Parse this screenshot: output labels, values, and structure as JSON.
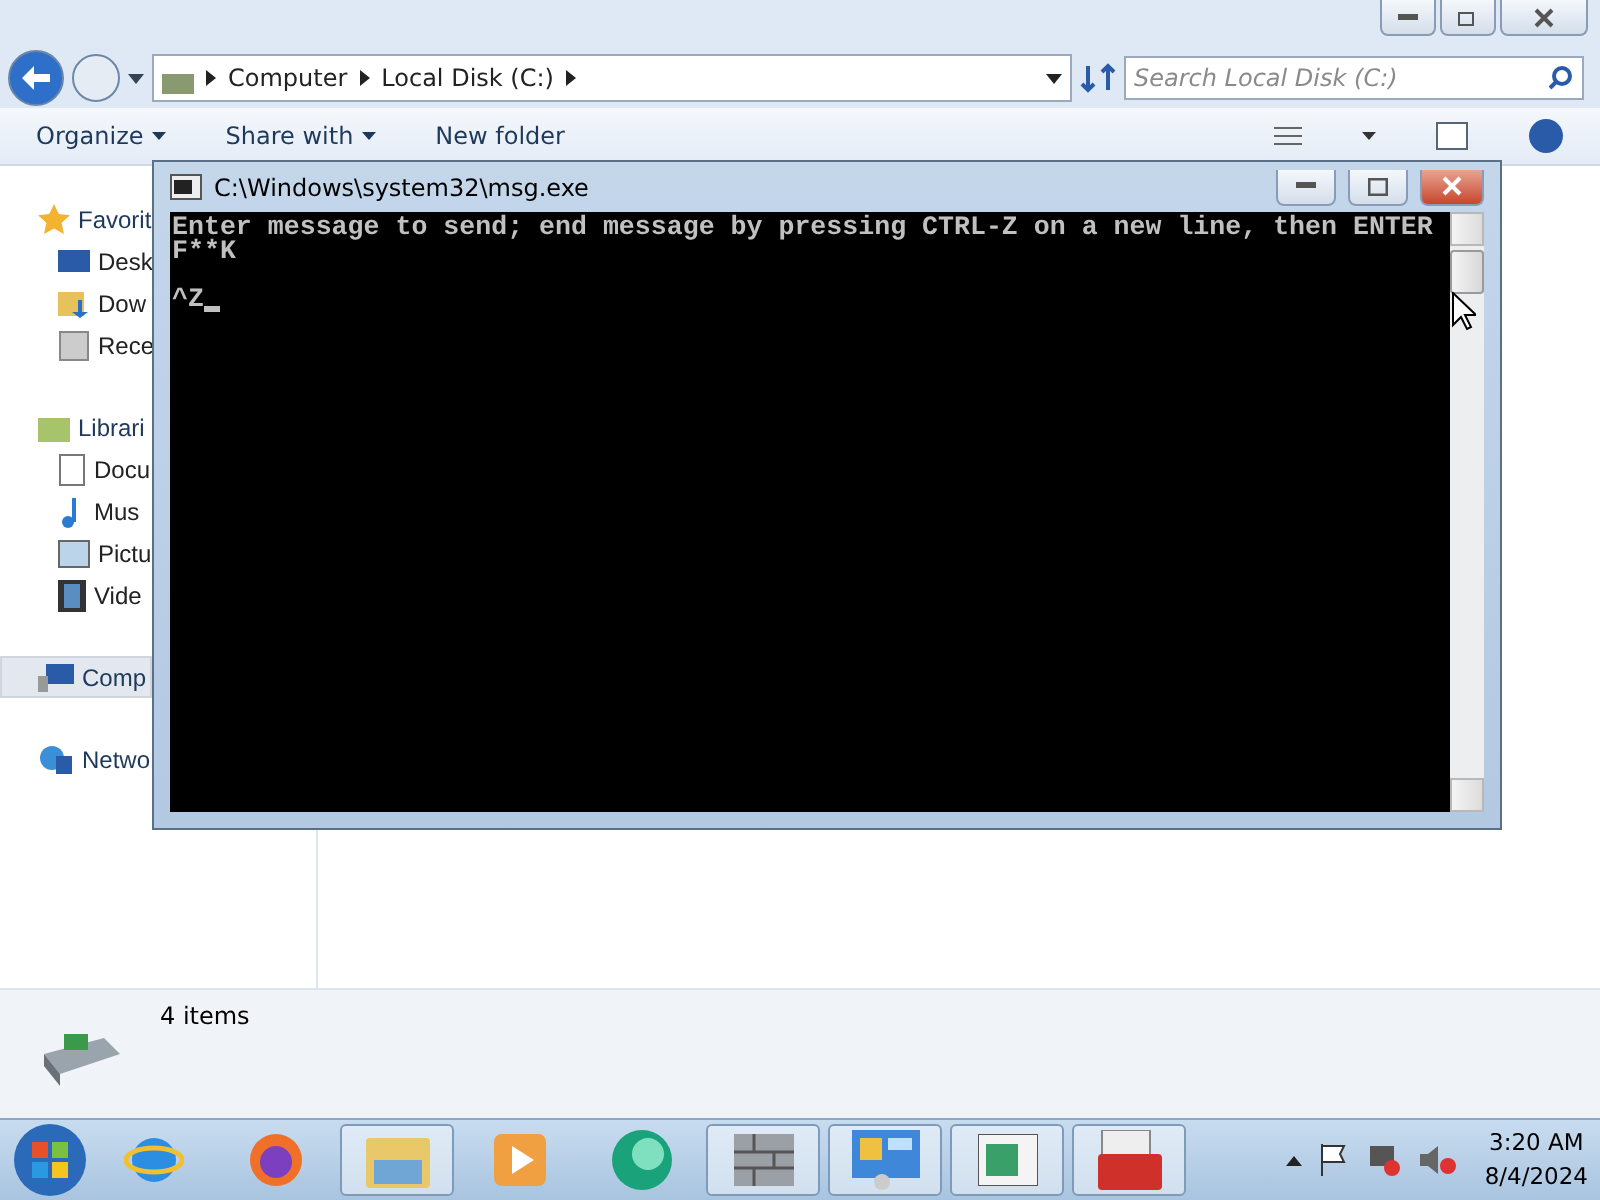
{
  "explorer": {
    "address": [
      "Computer",
      "Local Disk (C:)"
    ],
    "search": {
      "placeholder": "Search Local Disk (C:)"
    },
    "toolbar": [
      "Organize",
      "Share with",
      "New folder"
    ],
    "sidebar": [
      {
        "label": "Favorit",
        "kind": "favorites",
        "selected": false,
        "children": [
          {
            "label": "Desk",
            "kind": "desktop"
          },
          {
            "label": "Dow",
            "kind": "download"
          },
          {
            "label": "Rece",
            "kind": "recent"
          }
        ]
      },
      {
        "label": "Librari",
        "kind": "libraries",
        "selected": false,
        "children": [
          {
            "label": "Docu",
            "kind": "document"
          },
          {
            "label": "Mus",
            "kind": "music"
          },
          {
            "label": "Pictu",
            "kind": "picture"
          },
          {
            "label": "Vide",
            "kind": "video"
          }
        ]
      },
      {
        "label": "Comp",
        "kind": "computer",
        "selected": true
      },
      {
        "label": "Netwo",
        "kind": "network",
        "selected": false
      }
    ],
    "status": "4 items"
  },
  "console": {
    "title": "C:\\Windows\\system32\\msg.exe",
    "prompt": "Enter message to send; end message by pressing CTRL-Z on a new line, then ENTER",
    "message": "F**K",
    "terminator": "^Z",
    "cursor": true
  },
  "taskbar": {
    "apps": [
      {
        "kind": "ie",
        "open": false
      },
      {
        "kind": "firefox",
        "open": false
      },
      {
        "kind": "explorer",
        "open": true
      },
      {
        "kind": "media",
        "open": false
      },
      {
        "kind": "orb",
        "open": false
      },
      {
        "kind": "wall",
        "open": true
      },
      {
        "kind": "panel",
        "open": true
      },
      {
        "kind": "window",
        "open": true
      },
      {
        "kind": "toolbox",
        "open": true
      }
    ],
    "time": "3:20 AM",
    "date": "8/4/2024"
  }
}
